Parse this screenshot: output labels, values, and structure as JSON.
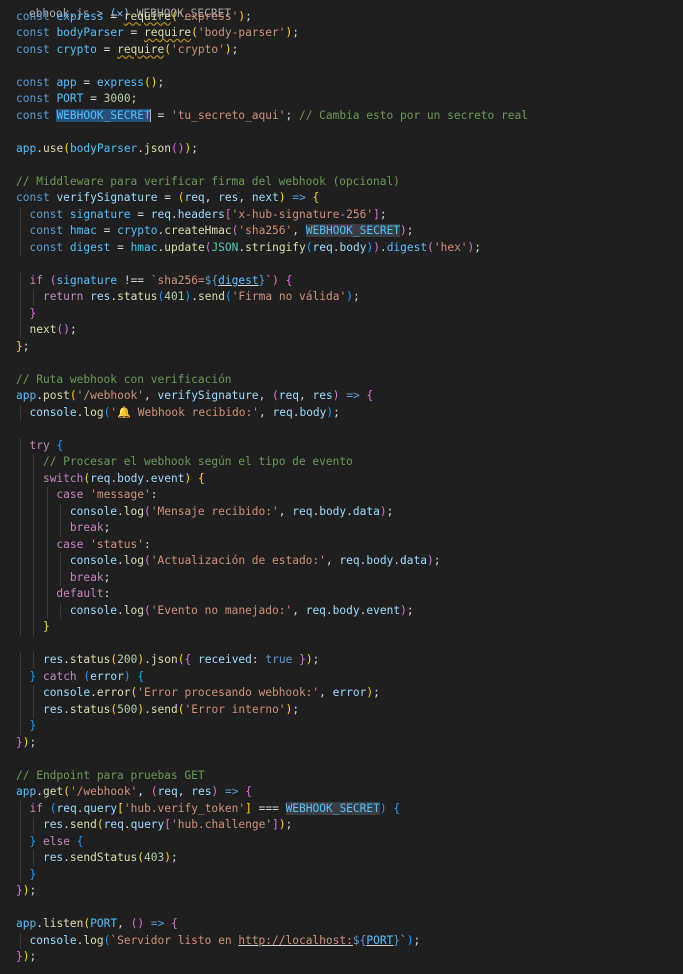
{
  "breadcrumb": {
    "file": "ebhook.js",
    "separator": " > ",
    "symbol_icon": "variable-symbol-icon",
    "symbol": "WEBHOOK_SECRET"
  },
  "colors": {
    "background": "#1f1f1f",
    "keyword": "#569cd6",
    "control_keyword": "#c586c0",
    "constant": "#4fc1ff",
    "property": "#9cdcfe",
    "function": "#dcdcaa",
    "string": "#ce9178",
    "number": "#b5cea8",
    "comment": "#6a9955",
    "selection": "#264f78"
  },
  "code_lines": [
    "const express = require('express');",
    "const bodyParser = require('body-parser');",
    "const crypto = require('crypto');",
    "",
    "const app = express();",
    "const PORT = 3000;",
    "const WEBHOOK_SECRET = 'tu_secreto_aqui'; // Cambia esto por un secreto real",
    "",
    "app.use(bodyParser.json());",
    "",
    "// Middleware para verificar firma del webhook (opcional)",
    "const verifySignature = (req, res, next) => {",
    "  const signature = req.headers['x-hub-signature-256'];",
    "  const hmac = crypto.createHmac('sha256', WEBHOOK_SECRET);",
    "  const digest = hmac.update(JSON.stringify(req.body)).digest('hex');",
    "",
    "  if (signature !== `sha256=${digest}`) {",
    "    return res.status(401).send('Firma no válida');",
    "  }",
    "  next();",
    "};",
    "",
    "// Ruta webhook con verificación",
    "app.post('/webhook', verifySignature, (req, res) => {",
    "  console.log('🔔 Webhook recibido:', req.body);",
    "",
    "  try {",
    "    // Procesar el webhook según el tipo de evento",
    "    switch(req.body.event) {",
    "      case 'message':",
    "        console.log('Mensaje recibido:', req.body.data);",
    "        break;",
    "      case 'status':",
    "        console.log('Actualización de estado:', req.body.data);",
    "        break;",
    "      default:",
    "        console.log('Evento no manejado:', req.body.event);",
    "    }",
    "",
    "    res.status(200).json({ received: true });",
    "  } catch (error) {",
    "    console.error('Error procesando webhook:', error);",
    "    res.status(500).send('Error interno');",
    "  }",
    "});",
    "",
    "// Endpoint para pruebas GET",
    "app.get('/webhook', (req, res) => {",
    "  if (req.query['hub.verify_token'] === WEBHOOK_SECRET) {",
    "    res.send(req.query['hub.challenge']);",
    "  } else {",
    "    res.sendStatus(403);",
    "  }",
    "});",
    "",
    "app.listen(PORT, () => {",
    "  console.log(`Servidor listo en http://localhost:${PORT}`);",
    "});"
  ]
}
